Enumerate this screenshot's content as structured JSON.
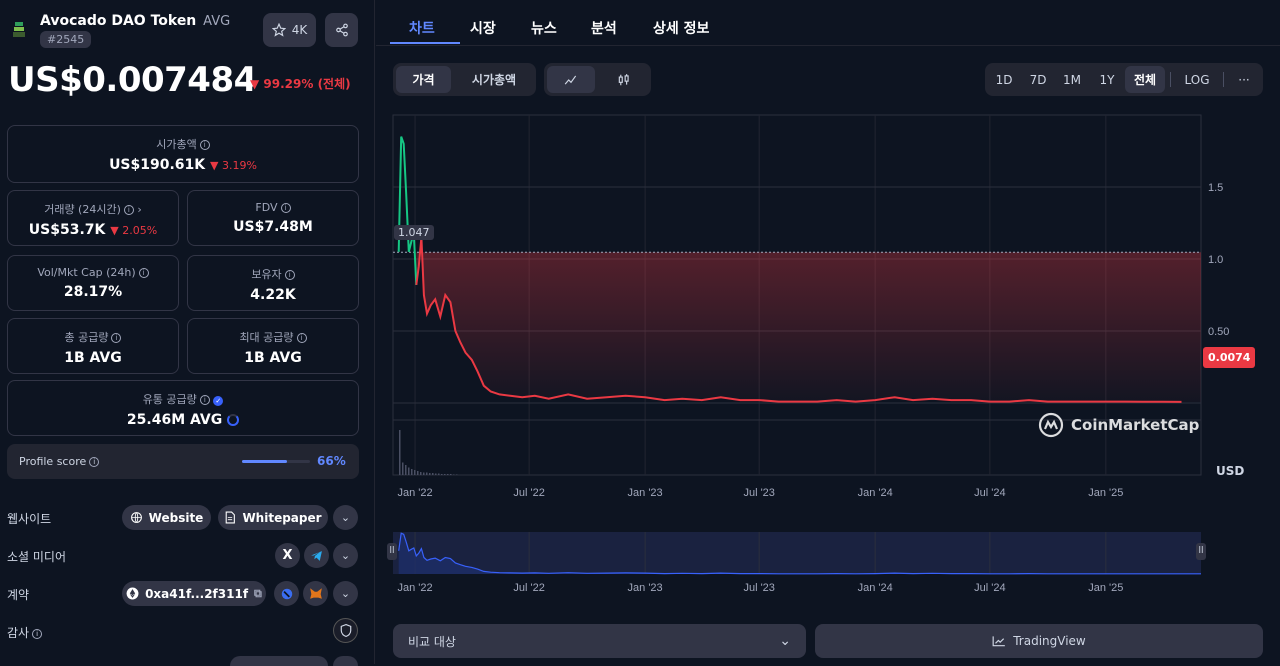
{
  "coin": {
    "name": "Avocado DAO Token",
    "symbol": "AVG",
    "rank": "#2545",
    "watchlist_count": "4K"
  },
  "price": {
    "value": "US$0.007484",
    "change": "99.29% (전체)"
  },
  "stats": {
    "market_cap": {
      "label": "시가총액",
      "value": "US$190.61K",
      "change": "3.19%"
    },
    "volume": {
      "label": "거래량 (24시간)",
      "value": "US$53.7K",
      "change": "2.05%"
    },
    "fdv": {
      "label": "FDV",
      "value": "US$7.48M"
    },
    "vol_mkt_cap": {
      "label": "Vol/Mkt Cap (24h)",
      "value": "28.17%"
    },
    "holders": {
      "label": "보유자",
      "value": "4.22K"
    },
    "total_supply": {
      "label": "총 공급량",
      "value": "1B AVG"
    },
    "max_supply": {
      "label": "최대 공급량",
      "value": "1B AVG"
    },
    "circulating_supply": {
      "label": "유통 공급량",
      "value": "25.46M AVG"
    }
  },
  "profile": {
    "label": "Profile score",
    "value": "66%",
    "fill": 0.66
  },
  "links": {
    "website_label": "웹사이트",
    "website_btn": "Website",
    "whitepaper_btn": "Whitepaper",
    "social_label": "소셜 미디어",
    "contract_label": "계약",
    "contract_addr": "0xa41f...2f311f",
    "audit_label": "감사"
  },
  "tabs": [
    "차트",
    "시장",
    "뉴스",
    "분석",
    "상세 정보"
  ],
  "chart_controls": {
    "type_tabs": [
      "가격",
      "시가총액"
    ],
    "ranges": [
      "1D",
      "7D",
      "1M",
      "1Y",
      "전체",
      "LOG"
    ],
    "more": "···",
    "currency": "USD",
    "watermark": "CoinMarketCap",
    "open_label": "1.047",
    "current_label": "0.0074"
  },
  "chart_data": {
    "type": "line",
    "x_ticks": [
      "Jan '22",
      "Jul '22",
      "Jan '23",
      "Jul '23",
      "Jan '24",
      "Jul '24",
      "Jan '25"
    ],
    "y_ticks": [
      "1.5",
      "1.0",
      "0.50"
    ],
    "ylim": [
      -0.5,
      2.0
    ],
    "reference_value": 1.047,
    "last_value": 0.0074,
    "series": [
      {
        "x": [
          "2021-12-06",
          "2021-12-10",
          "2021-12-14",
          "2021-12-18",
          "2021-12-22",
          "2021-12-26",
          "2021-12-30",
          "2022-01-03",
          "2022-01-07",
          "2022-01-11",
          "2022-01-15",
          "2022-01-20",
          "2022-01-26",
          "2022-02-02",
          "2022-02-10",
          "2022-02-18",
          "2022-02-26",
          "2022-03-06",
          "2022-03-14",
          "2022-03-22",
          "2022-04-01",
          "2022-04-10",
          "2022-04-20",
          "2022-05-01",
          "2022-05-15",
          "2022-06-01",
          "2022-06-20",
          "2022-07-10",
          "2022-08-01",
          "2022-09-01",
          "2022-10-01",
          "2022-11-01",
          "2022-12-01",
          "2023-01-01",
          "2023-02-01",
          "2023-03-01",
          "2023-04-01",
          "2023-05-01",
          "2023-06-01",
          "2023-07-01",
          "2023-08-01",
          "2023-09-01",
          "2023-10-01",
          "2023-11-01",
          "2023-12-01",
          "2024-01-01",
          "2024-02-01",
          "2024-03-01",
          "2024-04-01",
          "2024-05-01",
          "2024-06-01",
          "2024-07-01",
          "2024-08-01",
          "2024-09-01",
          "2024-10-01",
          "2024-11-01",
          "2024-12-01",
          "2025-01-01",
          "2025-02-01",
          "2025-03-01",
          "2025-04-01",
          "2025-05-01"
        ],
        "y": [
          1.05,
          1.85,
          1.8,
          1.45,
          1.05,
          1.12,
          1.18,
          0.82,
          0.95,
          1.15,
          0.75,
          0.62,
          0.68,
          0.72,
          0.6,
          0.75,
          0.7,
          0.5,
          0.42,
          0.35,
          0.3,
          0.22,
          0.12,
          0.08,
          0.06,
          0.05,
          0.04,
          0.05,
          0.03,
          0.06,
          0.03,
          0.04,
          0.05,
          0.04,
          0.02,
          0.03,
          0.02,
          0.04,
          0.02,
          0.02,
          0.01,
          0.01,
          0.01,
          0.02,
          0.01,
          0.02,
          0.04,
          0.02,
          0.03,
          0.02,
          0.02,
          0.01,
          0.01,
          0.02,
          0.01,
          0.01,
          0.01,
          0.01,
          0.01,
          0.008,
          0.008,
          0.0074
        ]
      }
    ],
    "volume": [
      0.9,
      0.25,
      0.2,
      0.15,
      0.12,
      0.1,
      0.08,
      0.06,
      0.05,
      0.05,
      0.04,
      0.04,
      0.03,
      0.03,
      0.02,
      0.02,
      0.02,
      0.02,
      0.01,
      0.01
    ],
    "nav_x_ticks": [
      "Jan '22",
      "Jul '22",
      "Jan '23",
      "Jul '23",
      "Jan '24",
      "Jul '24",
      "Jan '25"
    ]
  },
  "bottom": {
    "compare_label": "비교 대상",
    "tradingview_label": "TradingView"
  }
}
